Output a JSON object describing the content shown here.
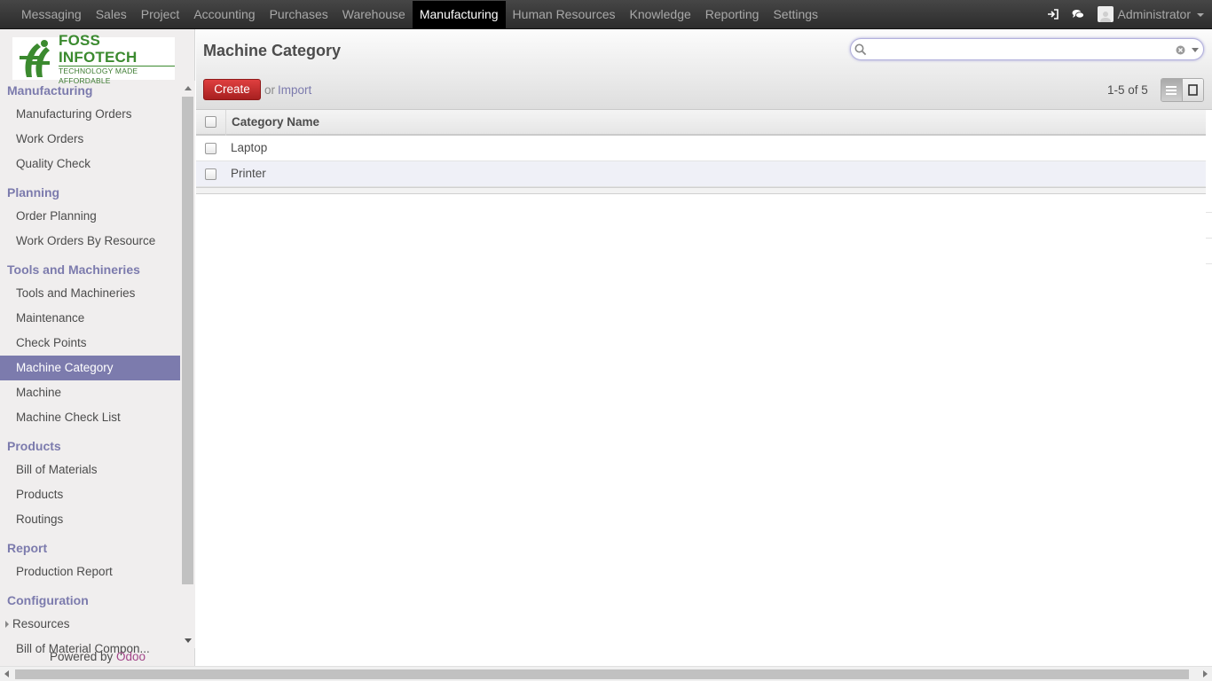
{
  "topbar": {
    "menu": [
      "Messaging",
      "Sales",
      "Project",
      "Accounting",
      "Purchases",
      "Warehouse",
      "Manufacturing",
      "Human Resources",
      "Knowledge",
      "Reporting",
      "Settings"
    ],
    "active_menu": "Manufacturing",
    "user_name": "Administrator",
    "icons": [
      "sign-in-icon",
      "chat-icon"
    ]
  },
  "logo": {
    "brand": "FOSS INFOTECH",
    "tagline": "TECHNOLOGY MADE AFFORDABLE"
  },
  "sidebar": {
    "sections": [
      {
        "title": "Manufacturing",
        "items": [
          "Manufacturing Orders",
          "Work Orders",
          "Quality Check"
        ]
      },
      {
        "title": "Planning",
        "items": [
          "Order Planning",
          "Work Orders By Resource"
        ]
      },
      {
        "title": "Tools and Machineries",
        "items": [
          "Tools and Machineries",
          "Maintenance",
          "Check Points",
          "Machine Category",
          "Machine",
          "Machine Check List"
        ]
      },
      {
        "title": "Products",
        "items": [
          "Bill of Materials",
          "Products",
          "Routings"
        ]
      },
      {
        "title": "Report",
        "items": [
          "Production Report"
        ]
      },
      {
        "title": "Configuration",
        "items": [
          "Resources",
          "Bill of Material Compon..."
        ]
      }
    ],
    "active_item": "Machine Category",
    "powered_prefix": "Powered by",
    "powered_brand": "Odoo"
  },
  "header": {
    "title": "Machine Category",
    "search_value": "",
    "create_label": "Create",
    "or_label": "or",
    "import_label": "Import",
    "pager": "1-5 of 5"
  },
  "list": {
    "columns": [
      "Category Name"
    ],
    "rows": [
      {
        "name": "Laptop"
      },
      {
        "name": "Printer"
      }
    ]
  },
  "colors": {
    "accent": "#7c7bad",
    "create_button": "#c42828",
    "active_menu_bg": "#000000"
  }
}
